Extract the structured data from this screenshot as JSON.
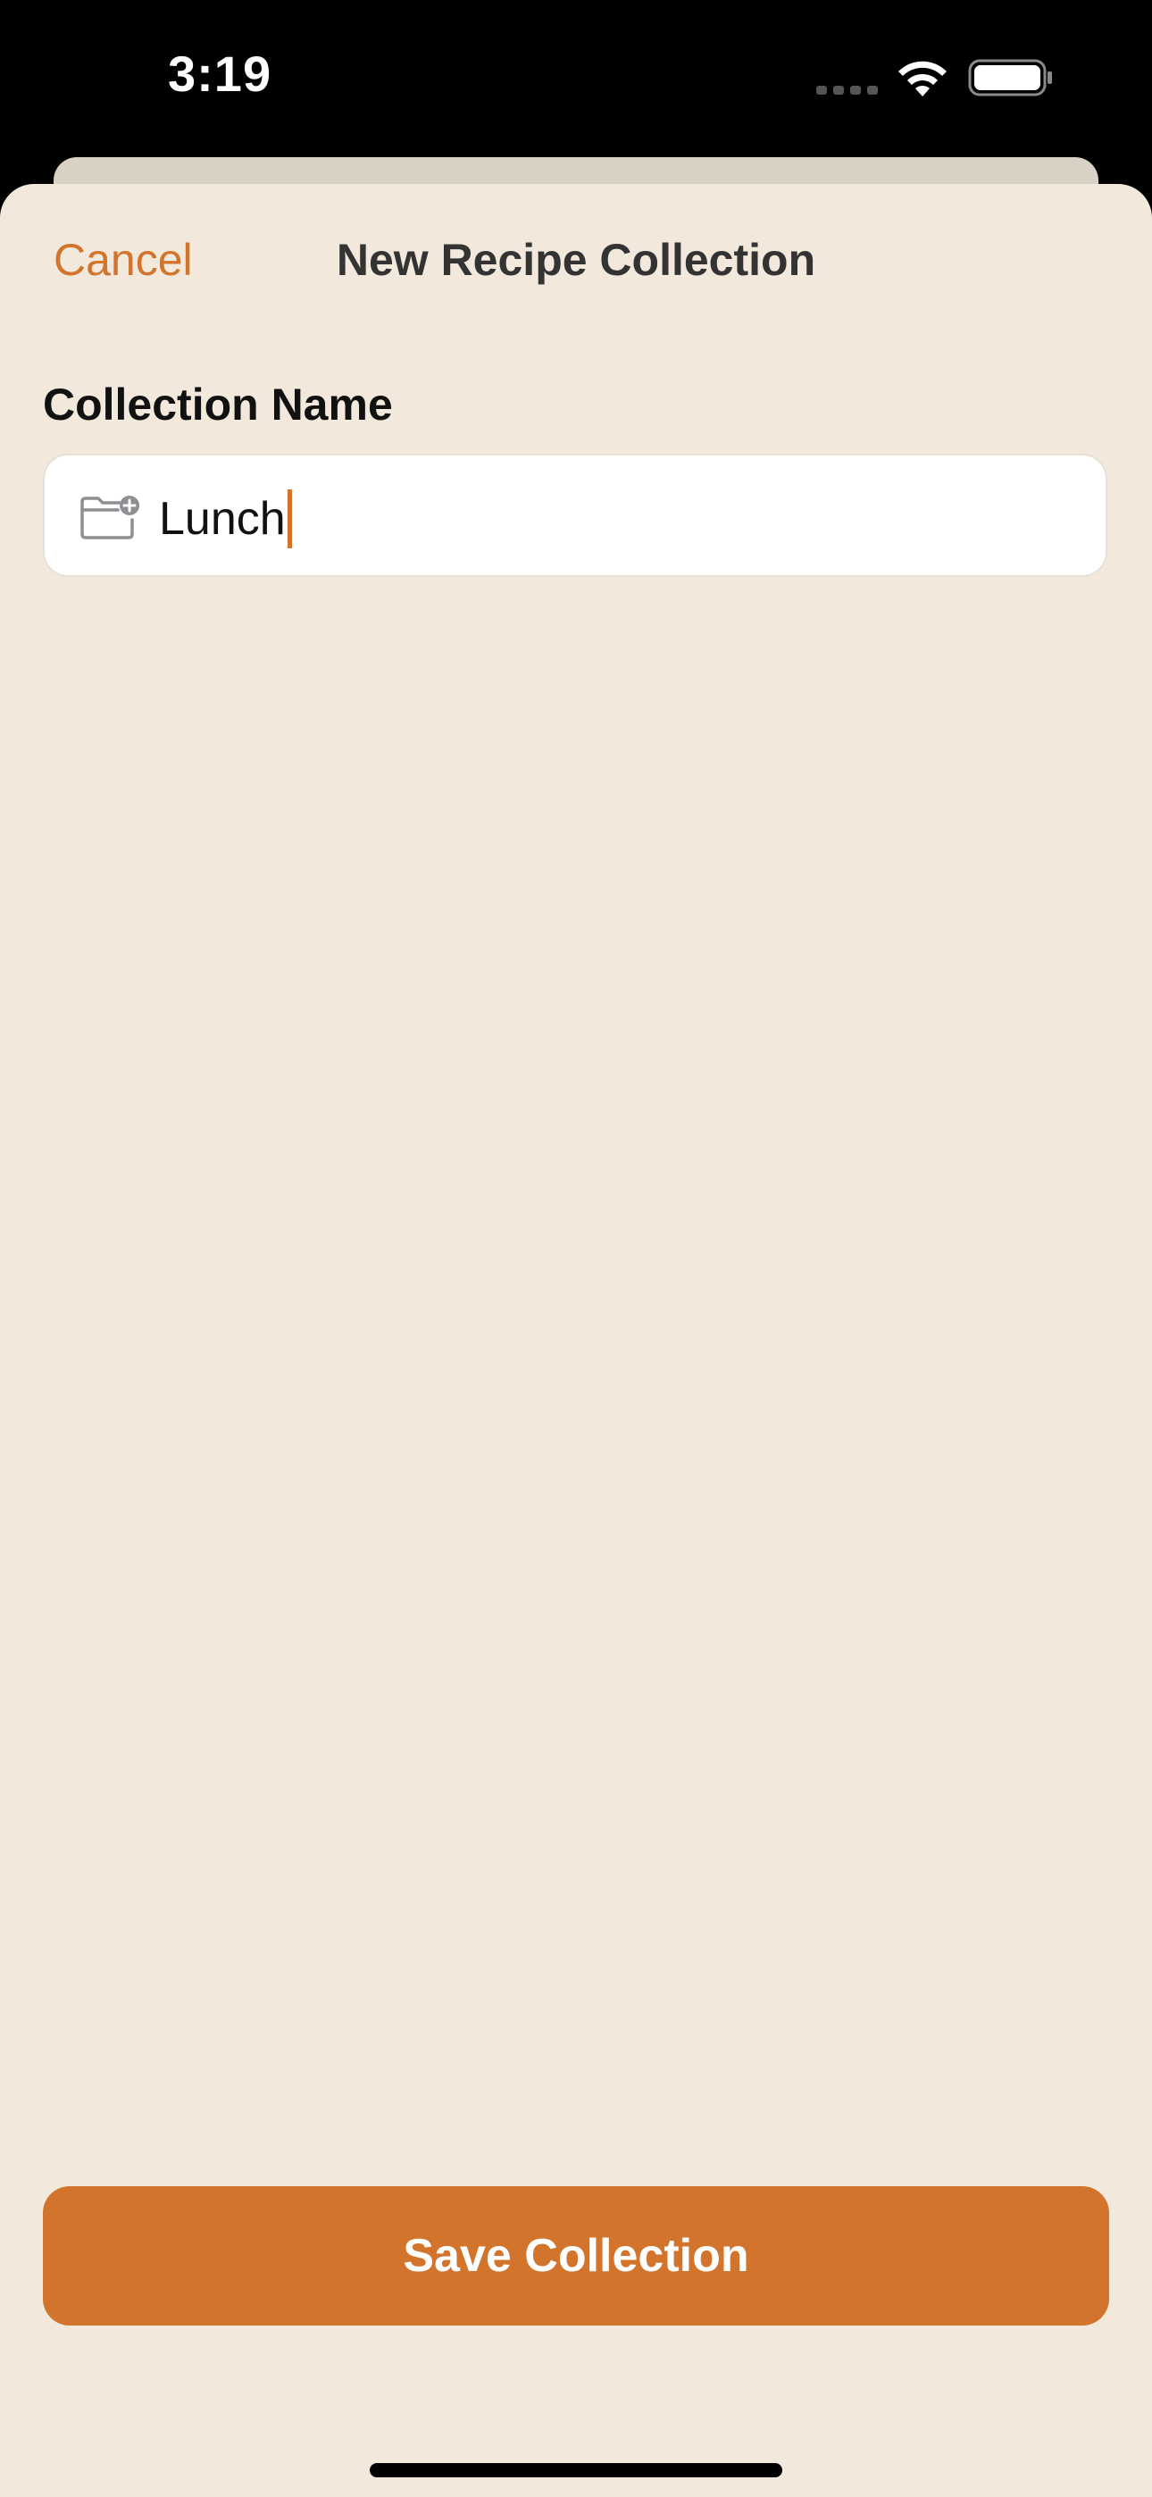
{
  "status_bar": {
    "time": "3:19"
  },
  "nav": {
    "cancel_label": "Cancel",
    "title": "New Recipe Collection"
  },
  "form": {
    "collection_name_label": "Collection Name",
    "collection_name_value": "Lunch",
    "field_icon": "folder-plus-icon"
  },
  "actions": {
    "save_label": "Save Collection"
  },
  "colors": {
    "accent": "#d2742c",
    "sheet_background": "#f2e9dc",
    "input_background": "#ffffff",
    "status_bar_background": "#000000"
  }
}
